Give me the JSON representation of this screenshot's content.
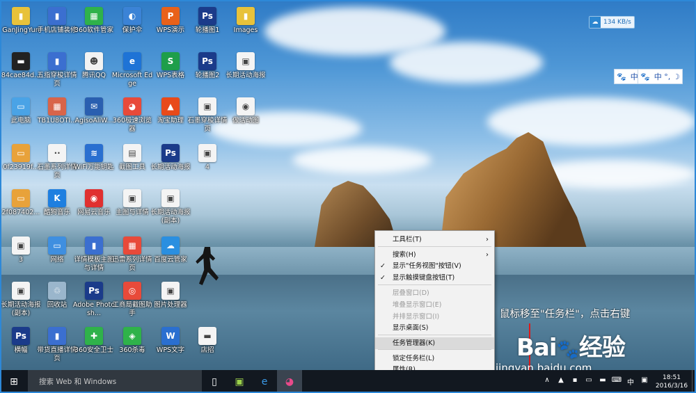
{
  "desktop_icons": [
    {
      "label": "GanJingYun",
      "color": "#e8c23a",
      "glyph": "▮"
    },
    {
      "label": "手机店铺装修",
      "color": "#3b6fd0",
      "glyph": "▮"
    },
    {
      "label": "360软件管家",
      "color": "#2fb24a",
      "glyph": "▦"
    },
    {
      "label": "保护伞",
      "color": "#3b83d6",
      "glyph": "◐"
    },
    {
      "label": "WPS演示",
      "color": "#e8611a",
      "glyph": "P"
    },
    {
      "label": "轮播图1",
      "color": "#1b3b8a",
      "glyph": "Ps"
    },
    {
      "label": "Images",
      "color": "#e8c23a",
      "glyph": "▮"
    },
    {
      "label": "84cae84d...",
      "color": "#222222",
      "glyph": "▬"
    },
    {
      "label": "五指穿梭详情页",
      "color": "#3b6fd0",
      "glyph": "▮"
    },
    {
      "label": "腾讯QQ",
      "color": "#f2f2f2",
      "glyph": "☻"
    },
    {
      "label": "Microsoft Edge",
      "color": "#1e73d6",
      "glyph": "e"
    },
    {
      "label": "WPS表格",
      "color": "#1e9e4a",
      "glyph": "S"
    },
    {
      "label": "轮播图2",
      "color": "#1b3b8a",
      "glyph": "Ps"
    },
    {
      "label": "长期活动海报",
      "color": "#f4f4f4",
      "glyph": "▣"
    },
    {
      "label": "此电脑",
      "color": "#4aa3e6",
      "glyph": "▭"
    },
    {
      "label": "TB1U8OTI...",
      "color": "#d8644a",
      "glyph": "▦"
    },
    {
      "label": "AgisoAliW...",
      "color": "#2a5fb0",
      "glyph": "✉"
    },
    {
      "label": "360极速浏览器",
      "color": "#e84a3a",
      "glyph": "◕"
    },
    {
      "label": "淘宝助理",
      "color": "#e84a1a",
      "glyph": "▲"
    },
    {
      "label": "石墨穿梭详情页",
      "color": "#f4f4f4",
      "glyph": "▣"
    },
    {
      "label": "做活动图",
      "color": "#f4f4f4",
      "glyph": "◉"
    },
    {
      "label": "0f23919f...",
      "color": "#e8a23a",
      "glyph": "▭"
    },
    {
      "label": "石墨系列详情页",
      "color": "#f4f4f4",
      "glyph": "∙∙"
    },
    {
      "label": "WiFi万能钥匙",
      "color": "#2a6fd0",
      "glyph": "≋"
    },
    {
      "label": "截图工具",
      "color": "#f4f4f4",
      "glyph": "▤"
    },
    {
      "label": "长期活动海报",
      "color": "#1b3b8a",
      "glyph": "Ps"
    },
    {
      "label": "4",
      "color": "#f4f4f4",
      "glyph": "▣"
    },
    {
      "label": "2f087402...",
      "color": "#e8a23a",
      "glyph": "▭"
    },
    {
      "label": "酷狗音乐",
      "color": "#1e7fe0",
      "glyph": "K"
    },
    {
      "label": "网易云音乐",
      "color": "#e03030",
      "glyph": "◉"
    },
    {
      "label": "主图与详情",
      "color": "#f4f4f4",
      "glyph": "▣"
    },
    {
      "label": "长期活动海报(副本)",
      "color": "#f4f4f4",
      "glyph": "▣"
    },
    {
      "label": "3",
      "color": "#f4f4f4",
      "glyph": "▣"
    },
    {
      "label": "网络",
      "color": "#3f8fe0",
      "glyph": "▭"
    },
    {
      "label": "详情模板主图与详情",
      "color": "#3b6fd0",
      "glyph": "▮"
    },
    {
      "label": "迅雷系列详情页",
      "color": "#e84a3a",
      "glyph": "▦"
    },
    {
      "label": "百度云管家",
      "color": "#2a8fe0",
      "glyph": "☁"
    },
    {
      "label": "长期活动海报(副本)",
      "color": "#f4f4f4",
      "glyph": "▣"
    },
    {
      "label": "回收站",
      "color": "#9ab6cc",
      "glyph": "♲"
    },
    {
      "label": "Adobe Photosh...",
      "color": "#1b3b8a",
      "glyph": "Ps"
    },
    {
      "label": "工商局截图助手",
      "color": "#e84a3a",
      "glyph": "◎"
    },
    {
      "label": "图片处理器",
      "color": "#f4f4f4",
      "glyph": "▣"
    },
    {
      "label": "横幅",
      "color": "#1b3b8a",
      "glyph": "Ps"
    },
    {
      "label": "带货直播详情页",
      "color": "#3b6fd0",
      "glyph": "▮"
    },
    {
      "label": "360安全卫士",
      "color": "#2fb24a",
      "glyph": "✚"
    },
    {
      "label": "360杀毒",
      "color": "#2fb24a",
      "glyph": "◈"
    },
    {
      "label": "WPS文字",
      "color": "#2a6fd0",
      "glyph": "W"
    },
    {
      "label": "店招",
      "color": "#f4f4f4",
      "glyph": "▬"
    },
    {
      "label": "轮播图1",
      "color": "#f4f4f4",
      "glyph": "▣"
    }
  ],
  "net_meter": {
    "speed": "134 KB/s",
    "icon": "cloud-arrow-icon"
  },
  "ime_bar": {
    "left_text": "中",
    "right_text": "中 °, ☽"
  },
  "context_menu": {
    "items": [
      {
        "label": "工具栏(T)",
        "check": "",
        "arrow": "›",
        "disabled": false,
        "highlight": false
      },
      {
        "label": "搜索(H)",
        "check": "",
        "arrow": "›",
        "disabled": false,
        "highlight": false
      },
      {
        "label": "显示\"任务视图\"按钮(V)",
        "check": "✓",
        "arrow": "",
        "disabled": false,
        "highlight": false
      },
      {
        "label": "显示触摸键盘按钮(T)",
        "check": "✓",
        "arrow": "",
        "disabled": false,
        "highlight": false
      },
      {
        "label": "层叠窗口(D)",
        "check": "",
        "arrow": "",
        "disabled": true,
        "highlight": false
      },
      {
        "label": "堆叠显示窗口(E)",
        "check": "",
        "arrow": "",
        "disabled": true,
        "highlight": false
      },
      {
        "label": "并排显示窗口(I)",
        "check": "",
        "arrow": "",
        "disabled": true,
        "highlight": false
      },
      {
        "label": "显示桌面(S)",
        "check": "",
        "arrow": "",
        "disabled": false,
        "highlight": false
      },
      {
        "label": "任务管理器(K)",
        "check": "",
        "arrow": "",
        "disabled": false,
        "highlight": true
      },
      {
        "label": "锁定任务栏(L)",
        "check": "",
        "arrow": "",
        "disabled": false,
        "highlight": false
      },
      {
        "label": "属性(R)",
        "check": "",
        "arrow": "",
        "disabled": false,
        "highlight": false
      }
    ]
  },
  "annotation": {
    "text": "鼠标移至\"任务栏\"，点击右键"
  },
  "watermark": {
    "brand_a": "Bai",
    "brand_b": "经验",
    "paw": "🐾",
    "site": "jingyan.baidu.com"
  },
  "taskbar": {
    "start_icon": "windows-logo-icon",
    "search_placeholder": "搜索 Web 和 Windows",
    "pinned": [
      {
        "name": "task-view-button",
        "glyph": "▯"
      },
      {
        "name": "android-app-button",
        "glyph": "▣"
      },
      {
        "name": "ie-button",
        "glyph": "e"
      },
      {
        "name": "browser-360-button",
        "glyph": "◕"
      }
    ],
    "tray_icons": [
      {
        "name": "show-hidden-icons-chevron-icon",
        "glyph": "∧"
      },
      {
        "name": "tray-app-icon",
        "glyph": "▲"
      },
      {
        "name": "tray-badge-icon",
        "glyph": "▪"
      },
      {
        "name": "network-icon",
        "glyph": "▭"
      },
      {
        "name": "notification-icon",
        "glyph": "▬"
      },
      {
        "name": "touch-keyboard-icon",
        "glyph": "⌨"
      },
      {
        "name": "ime-chinese-icon",
        "glyph": "中"
      },
      {
        "name": "ime-paw-icon",
        "glyph": "▣"
      }
    ],
    "time": "18:51",
    "date": "2016/3/16"
  }
}
